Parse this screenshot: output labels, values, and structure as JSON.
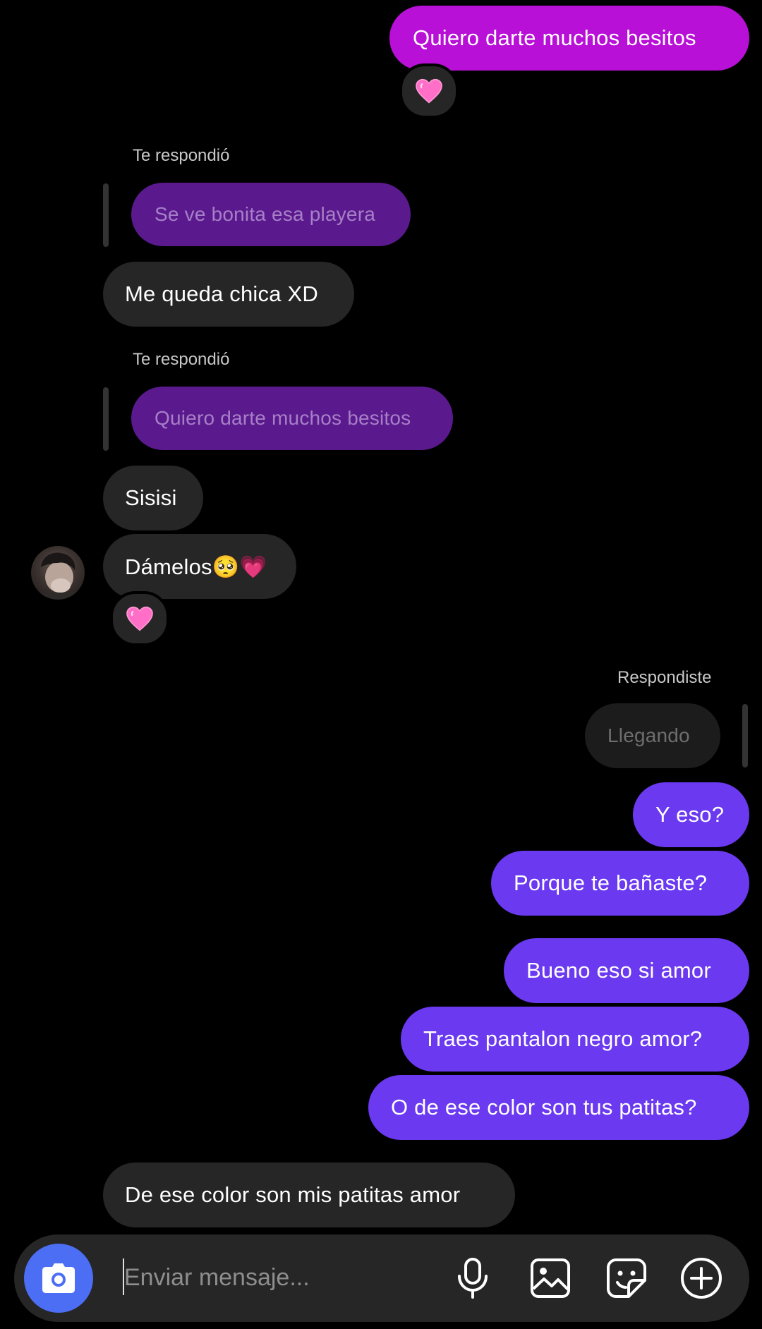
{
  "messages": [
    {
      "text": "Quiero darte muchos besitos",
      "reaction": "heart-emoji"
    },
    {
      "reply_label": "Te respondió",
      "quoted": "Se ve bonita esa playera",
      "text": "Me queda chica XD"
    },
    {
      "reply_label": "Te respondió",
      "quoted": "Quiero darte muchos besitos",
      "text": "Sisisi"
    },
    {
      "text": "Dámelos🥺💗",
      "reaction": "heart-emoji"
    },
    {
      "reply_label": "Respondiste",
      "quoted": "Llegando",
      "text": "Y eso?"
    },
    {
      "text": "Porque te bañaste?"
    },
    {
      "text": "Bueno eso si amor"
    },
    {
      "text": "Traes pantalon negro amor?"
    },
    {
      "text": "O de ese color son tus patitas?"
    },
    {
      "text": "De ese color son mis patitas amor"
    }
  ],
  "composer": {
    "placeholder": "Enviar mensaje...",
    "icons": [
      "camera-icon",
      "microphone-icon",
      "gallery-icon",
      "sticker-icon",
      "plus-icon"
    ]
  },
  "colors": {
    "sent_magenta": "#b810d6",
    "sent_blue": "#6a39f0",
    "received": "#262626",
    "camera_button": "#4c6ef5",
    "heart": "#ff6fc8"
  }
}
